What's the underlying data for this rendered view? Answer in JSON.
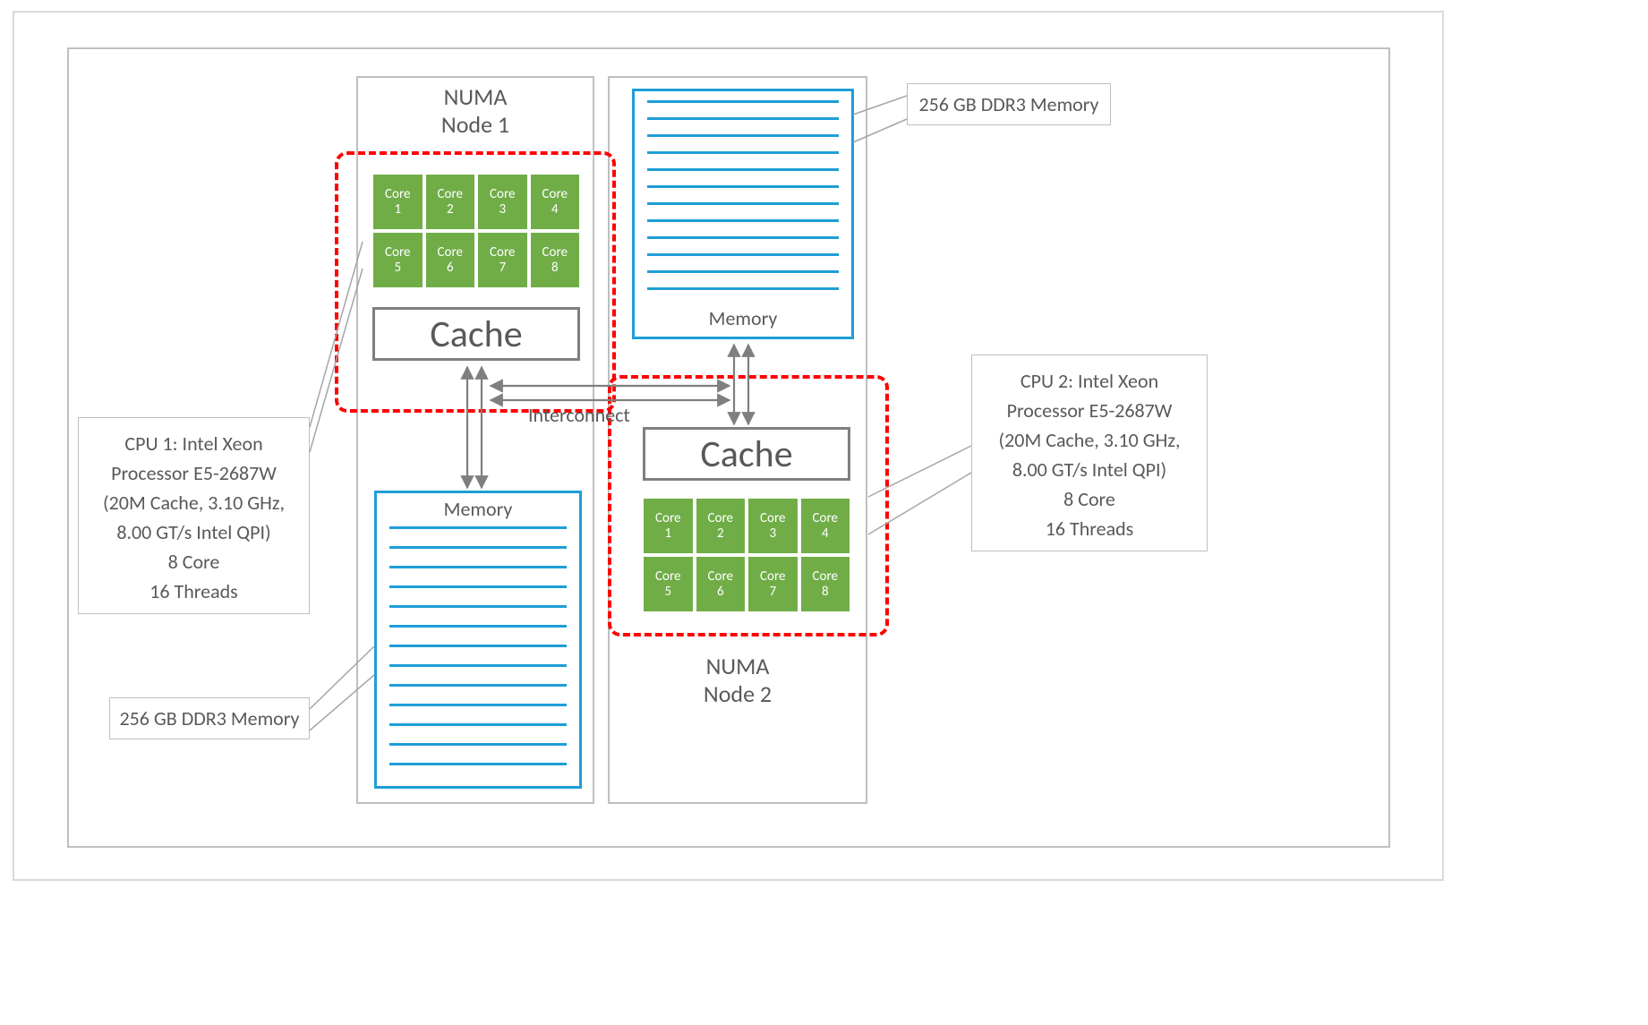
{
  "numa": {
    "node1": {
      "title_l1": "NUMA",
      "title_l2": "Node 1"
    },
    "node2": {
      "title_l1": "NUMA",
      "title_l2": "Node 2"
    }
  },
  "cores": {
    "label_prefix": "Core",
    "ids": [
      "1",
      "2",
      "3",
      "4",
      "5",
      "6",
      "7",
      "8"
    ]
  },
  "cache_label": "Cache",
  "memory_label": "Memory",
  "interconnect_label": "Interconnect",
  "callouts": {
    "cpu1": {
      "l1": "CPU 1: Intel Xeon",
      "l2": "Processor E5-2687W",
      "l3": "(20M Cache, 3.10 GHz,",
      "l4": "8.00 GT/s Intel QPI)",
      "l5": "8 Core",
      "l6": "16 Threads"
    },
    "cpu2": {
      "l1": "CPU 2: Intel Xeon",
      "l2": "Processor E5-2687W",
      "l3": "(20M Cache, 3.10 GHz,",
      "l4": "8.00 GT/s Intel QPI)",
      "l5": "8 Core",
      "l6": "16 Threads"
    },
    "mem1": "256 GB DDR3 Memory",
    "mem2": "256 GB DDR3 Memory"
  }
}
